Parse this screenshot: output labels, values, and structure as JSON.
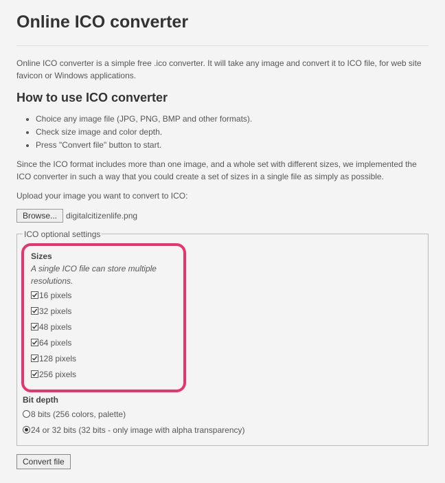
{
  "header": {
    "title": "Online ICO converter"
  },
  "intro": "Online ICO converter is a simple free .ico converter. It will take any image and convert it to ICO file, for web site favicon or Windows applications.",
  "howto": {
    "heading": "How to use ICO converter",
    "steps": [
      "Choice any image file (JPG, PNG, BMP and other formats).",
      "Check size image and color depth.",
      "Press \"Convert file\" button to start."
    ]
  },
  "explain": "Since the ICO format includes more than one image, and a whole set with different sizes, we implemented the ICO converter in such a way that you could create a set of sizes in a single file as simply as possible.",
  "upload": {
    "label": "Upload your image you want to convert to ICO:",
    "browse_label": "Browse...",
    "filename": "digitalcitizenlife.png"
  },
  "settings": {
    "legend": "ICO optional settings",
    "sizes": {
      "title": "Sizes",
      "hint": "A single ICO file can store multiple resolutions.",
      "options": [
        {
          "label": "16 pixels",
          "checked": true
        },
        {
          "label": "32 pixels",
          "checked": true
        },
        {
          "label": "48 pixels",
          "checked": true
        },
        {
          "label": "64 pixels",
          "checked": true
        },
        {
          "label": "128 pixels",
          "checked": true
        },
        {
          "label": "256 pixels",
          "checked": true
        }
      ]
    },
    "bitdepth": {
      "title": "Bit depth",
      "options": [
        {
          "label": "8 bits (256 colors, palette)",
          "selected": false
        },
        {
          "label": "24 or 32 bits (32 bits - only image with alpha transparency)",
          "selected": true
        }
      ]
    }
  },
  "actions": {
    "convert_label": "Convert file"
  }
}
